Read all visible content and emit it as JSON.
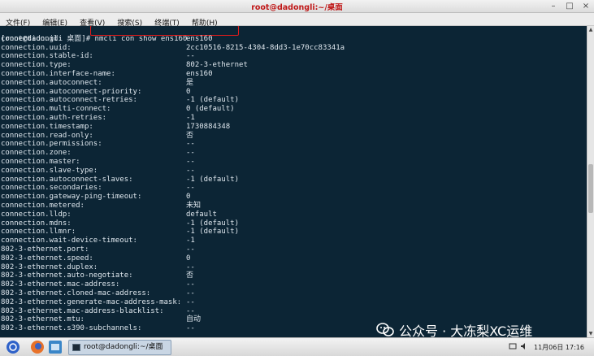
{
  "window": {
    "title": "root@dadongli:~/桌面",
    "minimize_glyph": "–",
    "maximize_glyph": "□",
    "close_glyph": "×"
  },
  "menu": [
    "文件(F)",
    "编辑(E)",
    "查看(V)",
    "搜索(S)",
    "终端(T)",
    "帮助(H)"
  ],
  "terminal": {
    "prompt": "[root@dadongli 桌面]# ",
    "command": "nmcli con show ens160",
    "rows": [
      {
        "key": "connection.id:",
        "value": "ens160"
      },
      {
        "key": "connection.uuid:",
        "value": "2cc10516-8215-4304-8dd3-1e70cc83341a"
      },
      {
        "key": "connection.stable-id:",
        "value": "--"
      },
      {
        "key": "connection.type:",
        "value": "802-3-ethernet"
      },
      {
        "key": "connection.interface-name:",
        "value": "ens160"
      },
      {
        "key": "connection.autoconnect:",
        "value": "是"
      },
      {
        "key": "connection.autoconnect-priority:",
        "value": "0"
      },
      {
        "key": "connection.autoconnect-retries:",
        "value": "-1 (default)"
      },
      {
        "key": "connection.multi-connect:",
        "value": "0 (default)"
      },
      {
        "key": "connection.auth-retries:",
        "value": "-1"
      },
      {
        "key": "connection.timestamp:",
        "value": "1730884348"
      },
      {
        "key": "connection.read-only:",
        "value": "否"
      },
      {
        "key": "connection.permissions:",
        "value": "--"
      },
      {
        "key": "connection.zone:",
        "value": "--"
      },
      {
        "key": "connection.master:",
        "value": "--"
      },
      {
        "key": "connection.slave-type:",
        "value": "--"
      },
      {
        "key": "connection.autoconnect-slaves:",
        "value": "-1 (default)"
      },
      {
        "key": "connection.secondaries:",
        "value": "--"
      },
      {
        "key": "connection.gateway-ping-timeout:",
        "value": "0"
      },
      {
        "key": "connection.metered:",
        "value": "未知"
      },
      {
        "key": "connection.lldp:",
        "value": "default"
      },
      {
        "key": "connection.mdns:",
        "value": "-1 (default)"
      },
      {
        "key": "connection.llmnr:",
        "value": "-1 (default)"
      },
      {
        "key": "connection.wait-device-timeout:",
        "value": "-1"
      },
      {
        "key": "802-3-ethernet.port:",
        "value": "--"
      },
      {
        "key": "802-3-ethernet.speed:",
        "value": "0"
      },
      {
        "key": "802-3-ethernet.duplex:",
        "value": "--"
      },
      {
        "key": "802-3-ethernet.auto-negotiate:",
        "value": "否"
      },
      {
        "key": "802-3-ethernet.mac-address:",
        "value": "--"
      },
      {
        "key": "802-3-ethernet.cloned-mac-address:",
        "value": "--"
      },
      {
        "key": "802-3-ethernet.generate-mac-address-mask:",
        "value": "--"
      },
      {
        "key": "802-3-ethernet.mac-address-blacklist:",
        "value": "--"
      },
      {
        "key": "802-3-ethernet.mtu:",
        "value": "自动"
      },
      {
        "key": "802-3-ethernet.s390-subchannels:",
        "value": "--"
      }
    ]
  },
  "watermark": {
    "text": "公众号 · 大冻梨XC运维",
    "icon": "wechat-channel-icon"
  },
  "taskbar": {
    "task_label": "root@dadongli:~/桌面",
    "clock": "11月06日 17:16",
    "tray_icons": [
      "network-icon",
      "volume-icon"
    ],
    "launcher_icons": [
      "app-menu-icon",
      "firefox-icon",
      "files-icon"
    ]
  },
  "colors": {
    "terminal_bg": "#0c2535",
    "terminal_fg": "#dfe7ee",
    "title_text": "#c01818",
    "highlight_box": "#e11b1b"
  }
}
